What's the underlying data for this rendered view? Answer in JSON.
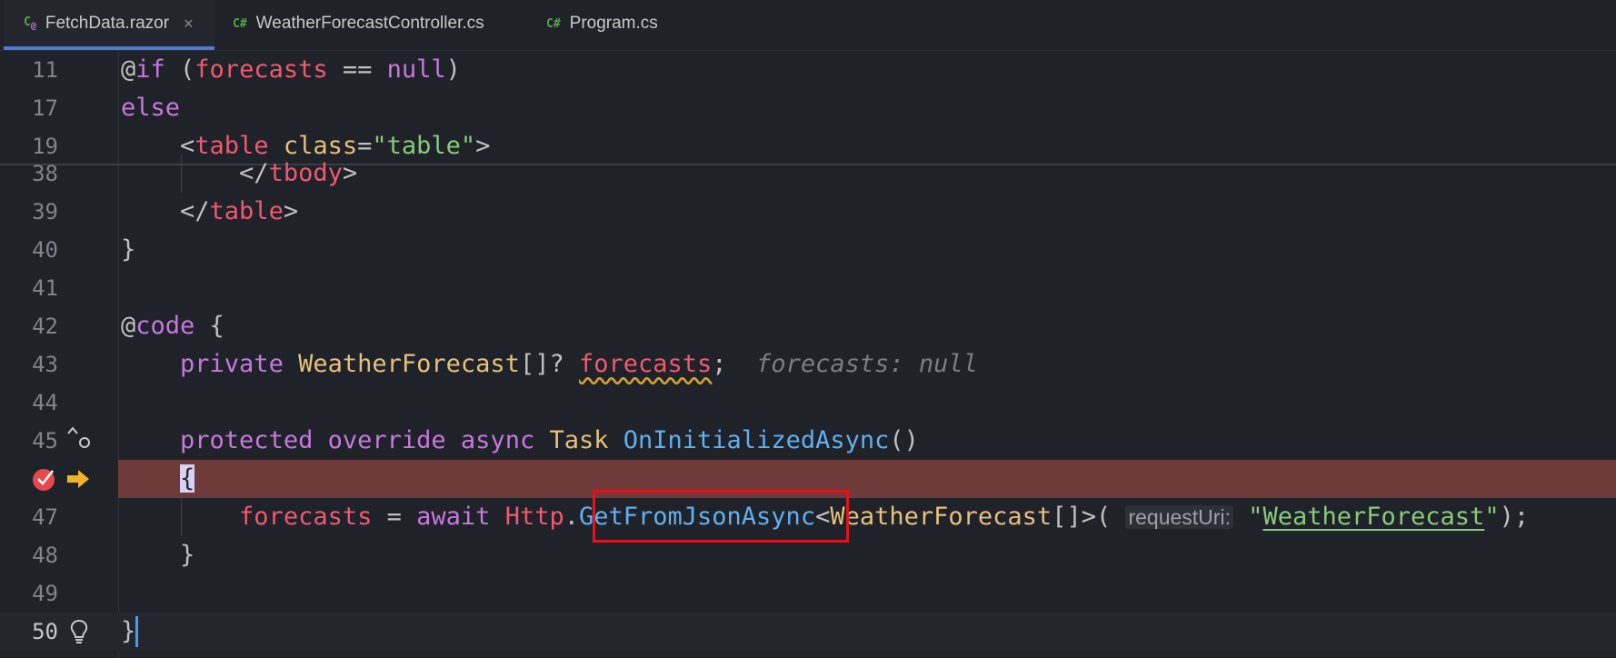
{
  "tabs": [
    {
      "icon": "C#",
      "label": "FetchData.razor",
      "active": true,
      "close": "×"
    },
    {
      "icon": "C#",
      "label": "WeatherForecastController.cs",
      "active": false
    },
    {
      "icon": "C#",
      "label": "Program.cs",
      "active": false
    }
  ],
  "lines": {
    "l11": "11",
    "l17": "17",
    "l19": "19",
    "l38": "38",
    "l39": "39",
    "l40": "40",
    "l41": "41",
    "l42": "42",
    "l43": "43",
    "l44": "44",
    "l45": "45",
    "l47": "47",
    "l48": "48",
    "l49": "49",
    "l50": "50"
  },
  "hints": {
    "forecasts_value": "forecasts: null",
    "request_uri": "requestUri:"
  },
  "gutter_icons": [
    "override-arrow-icon",
    "breakpoint-icon",
    "execution-pointer-icon",
    "lightbulb-icon"
  ],
  "colors": {
    "breakpoint_line": "#6f3a3a",
    "highlight_box": "#e0141e",
    "tab_underline": "#4a7ad2"
  }
}
